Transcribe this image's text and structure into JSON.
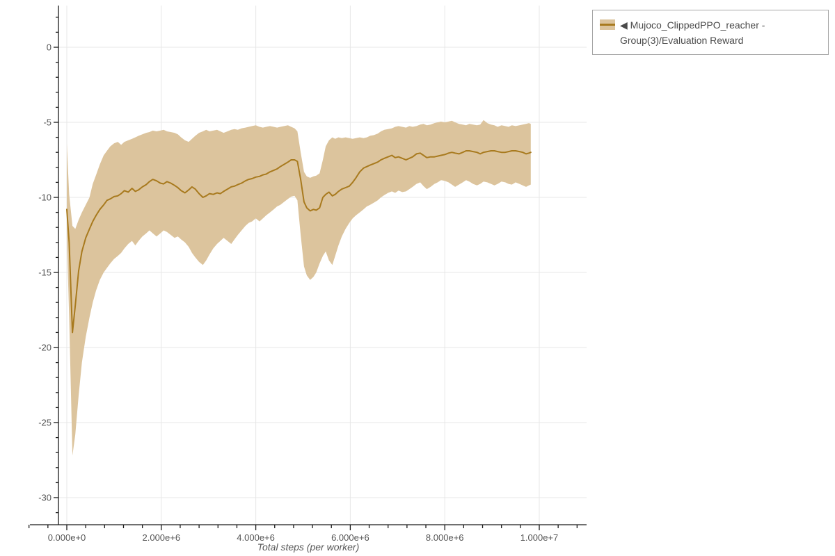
{
  "colors": {
    "background": "#ffffff",
    "axis": "#1a1a1a",
    "grid": "#e7e7e7",
    "tick_label": "#555555",
    "axis_label": "#555555",
    "legend_border": "#a6a6a6",
    "legend_text": "#4a4a4a"
  },
  "legend": {
    "label": "◀ Mujoco_ClippedPPO_reacher - Group(3)/Evaluation Reward"
  },
  "chart_data": {
    "type": "line",
    "title": "",
    "xlabel": "Total steps (per worker)",
    "ylabel": "",
    "xlim": [
      -800000,
      11200000
    ],
    "ylim": [
      -31.8,
      2.8
    ],
    "grid": true,
    "legend_position": "top-right",
    "x_ticks": [
      {
        "value": 0,
        "label": "0.000e+0"
      },
      {
        "value": 2000000,
        "label": "2.000e+6"
      },
      {
        "value": 4000000,
        "label": "4.000e+6"
      },
      {
        "value": 6000000,
        "label": "6.000e+6"
      },
      {
        "value": 8000000,
        "label": "8.000e+6"
      },
      {
        "value": 10000000,
        "label": "1.000e+7"
      }
    ],
    "x_minor_step": 400000,
    "y_ticks": [
      {
        "value": 0,
        "label": "0"
      },
      {
        "value": -5,
        "label": "-5"
      },
      {
        "value": -10,
        "label": "-10"
      },
      {
        "value": -15,
        "label": "-15"
      },
      {
        "value": -20,
        "label": "-20"
      },
      {
        "value": -25,
        "label": "-25"
      },
      {
        "value": -30,
        "label": "-30"
      }
    ],
    "y_minor_step": 1,
    "series": [
      {
        "name": "Mujoco_ClippedPPO_reacher - Group(3)/Evaluation Reward",
        "color": "#a87a1e",
        "band_color": "#dcc49d",
        "points_format": [
          "x_steps",
          "mean",
          "lower",
          "upper"
        ],
        "points": [
          [
            0,
            -10.8,
            -12.6,
            -6.4
          ],
          [
            50000,
            -13,
            -18,
            -9.8
          ],
          [
            120000,
            -19,
            -27.2,
            -11.9
          ],
          [
            180000,
            -17.2,
            -25.8,
            -12.1
          ],
          [
            250000,
            -14.9,
            -23.2,
            -11.5
          ],
          [
            320000,
            -13.6,
            -21,
            -11
          ],
          [
            400000,
            -12.7,
            -19.3,
            -10.5
          ],
          [
            480000,
            -12.1,
            -18,
            -10
          ],
          [
            550000,
            -11.6,
            -17,
            -9.1
          ],
          [
            620000,
            -11.2,
            -16.2,
            -8.5
          ],
          [
            700000,
            -10.8,
            -15.5,
            -7.8
          ],
          [
            780000,
            -10.5,
            -15,
            -7.2
          ],
          [
            850000,
            -10.2,
            -14.7,
            -6.9
          ],
          [
            920000,
            -10.1,
            -14.4,
            -6.6
          ],
          [
            1000000,
            -9.95,
            -14.1,
            -6.4
          ],
          [
            1080000,
            -9.9,
            -13.9,
            -6.3
          ],
          [
            1150000,
            -9.75,
            -13.7,
            -6.5
          ],
          [
            1220000,
            -9.55,
            -13.4,
            -6.3
          ],
          [
            1300000,
            -9.65,
            -13.1,
            -6.2
          ],
          [
            1380000,
            -9.4,
            -12.9,
            -6.1
          ],
          [
            1450000,
            -9.6,
            -13.2,
            -6
          ],
          [
            1520000,
            -9.5,
            -12.9,
            -5.9
          ],
          [
            1600000,
            -9.3,
            -12.6,
            -5.8
          ],
          [
            1680000,
            -9.15,
            -12.4,
            -5.7
          ],
          [
            1750000,
            -8.95,
            -12.2,
            -5.65
          ],
          [
            1820000,
            -8.8,
            -12.4,
            -5.55
          ],
          [
            1900000,
            -8.9,
            -12.6,
            -5.6
          ],
          [
            1980000,
            -9.05,
            -12.4,
            -5.55
          ],
          [
            2050000,
            -9.1,
            -12.2,
            -5.5
          ],
          [
            2120000,
            -8.95,
            -12.3,
            -5.6
          ],
          [
            2200000,
            -9.05,
            -12.5,
            -5.65
          ],
          [
            2280000,
            -9.2,
            -12.7,
            -5.7
          ],
          [
            2350000,
            -9.35,
            -12.6,
            -5.8
          ],
          [
            2420000,
            -9.55,
            -12.8,
            -6
          ],
          [
            2500000,
            -9.7,
            -13,
            -6.2
          ],
          [
            2580000,
            -9.5,
            -13.3,
            -6.3
          ],
          [
            2650000,
            -9.3,
            -13.7,
            -6.1
          ],
          [
            2720000,
            -9.45,
            -14,
            -5.9
          ],
          [
            2800000,
            -9.75,
            -14.3,
            -5.7
          ],
          [
            2880000,
            -10,
            -14.5,
            -5.6
          ],
          [
            2950000,
            -9.9,
            -14.2,
            -5.5
          ],
          [
            3020000,
            -9.75,
            -13.8,
            -5.6
          ],
          [
            3100000,
            -9.8,
            -13.4,
            -5.55
          ],
          [
            3180000,
            -9.7,
            -13.1,
            -5.5
          ],
          [
            3250000,
            -9.75,
            -12.9,
            -5.6
          ],
          [
            3320000,
            -9.6,
            -12.7,
            -5.7
          ],
          [
            3400000,
            -9.45,
            -12.9,
            -5.6
          ],
          [
            3480000,
            -9.3,
            -13.1,
            -5.5
          ],
          [
            3550000,
            -9.25,
            -12.8,
            -5.45
          ],
          [
            3620000,
            -9.15,
            -12.5,
            -5.5
          ],
          [
            3700000,
            -9.05,
            -12.2,
            -5.4
          ],
          [
            3780000,
            -8.9,
            -11.9,
            -5.35
          ],
          [
            3850000,
            -8.8,
            -11.7,
            -5.3
          ],
          [
            3920000,
            -8.75,
            -11.6,
            -5.25
          ],
          [
            4000000,
            -8.65,
            -11.4,
            -5.2
          ],
          [
            4080000,
            -8.6,
            -11.6,
            -5.3
          ],
          [
            4150000,
            -8.5,
            -11.4,
            -5.35
          ],
          [
            4220000,
            -8.45,
            -11.2,
            -5.3
          ],
          [
            4300000,
            -8.3,
            -11,
            -5.25
          ],
          [
            4380000,
            -8.2,
            -10.8,
            -5.3
          ],
          [
            4450000,
            -8.1,
            -10.6,
            -5.35
          ],
          [
            4520000,
            -7.95,
            -10.5,
            -5.3
          ],
          [
            4600000,
            -7.8,
            -10.3,
            -5.25
          ],
          [
            4680000,
            -7.65,
            -10.1,
            -5.2
          ],
          [
            4750000,
            -7.5,
            -9.95,
            -5.3
          ],
          [
            4820000,
            -7.5,
            -9.9,
            -5.4
          ],
          [
            4880000,
            -7.6,
            -10.2,
            -5.6
          ],
          [
            4950000,
            -8.8,
            -12.5,
            -7
          ],
          [
            5020000,
            -10.3,
            -14.6,
            -8.3
          ],
          [
            5080000,
            -10.7,
            -15.2,
            -8.6
          ],
          [
            5150000,
            -10.9,
            -15.5,
            -8.7
          ],
          [
            5220000,
            -10.8,
            -15.3,
            -8.6
          ],
          [
            5280000,
            -10.85,
            -15,
            -8.55
          ],
          [
            5350000,
            -10.7,
            -14.4,
            -8.4
          ],
          [
            5420000,
            -10,
            -13.9,
            -7.5
          ],
          [
            5480000,
            -9.8,
            -13.6,
            -6.6
          ],
          [
            5550000,
            -9.65,
            -14.2,
            -6.2
          ],
          [
            5620000,
            -9.9,
            -14.5,
            -6
          ],
          [
            5680000,
            -9.8,
            -13.9,
            -6.1
          ],
          [
            5750000,
            -9.6,
            -13.2,
            -6
          ],
          [
            5820000,
            -9.45,
            -12.6,
            -6.05
          ],
          [
            5900000,
            -9.35,
            -12.1,
            -6
          ],
          [
            5980000,
            -9.25,
            -11.7,
            -6.05
          ],
          [
            6050000,
            -9,
            -11.4,
            -6.1
          ],
          [
            6120000,
            -8.7,
            -11.2,
            -6.05
          ],
          [
            6200000,
            -8.3,
            -11,
            -6
          ],
          [
            6280000,
            -8.05,
            -10.8,
            -6.05
          ],
          [
            6350000,
            -7.95,
            -10.6,
            -6
          ],
          [
            6420000,
            -7.85,
            -10.5,
            -5.9
          ],
          [
            6500000,
            -7.75,
            -10.35,
            -5.85
          ],
          [
            6580000,
            -7.65,
            -10.2,
            -5.75
          ],
          [
            6650000,
            -7.5,
            -10,
            -5.6
          ],
          [
            6720000,
            -7.4,
            -9.85,
            -5.5
          ],
          [
            6800000,
            -7.3,
            -9.7,
            -5.45
          ],
          [
            6880000,
            -7.2,
            -9.6,
            -5.4
          ],
          [
            6950000,
            -7.35,
            -9.7,
            -5.3
          ],
          [
            7020000,
            -7.3,
            -9.55,
            -5.25
          ],
          [
            7100000,
            -7.4,
            -9.65,
            -5.3
          ],
          [
            7180000,
            -7.5,
            -9.6,
            -5.35
          ],
          [
            7250000,
            -7.4,
            -9.45,
            -5.25
          ],
          [
            7320000,
            -7.3,
            -9.3,
            -5.3
          ],
          [
            7400000,
            -7.1,
            -9.1,
            -5.25
          ],
          [
            7480000,
            -7.05,
            -9,
            -5.15
          ],
          [
            7550000,
            -7.2,
            -9.25,
            -5.1
          ],
          [
            7620000,
            -7.35,
            -9.45,
            -5.2
          ],
          [
            7700000,
            -7.3,
            -9.3,
            -5.15
          ],
          [
            7780000,
            -7.3,
            -9.1,
            -5.05
          ],
          [
            7850000,
            -7.25,
            -9,
            -5
          ],
          [
            7920000,
            -7.2,
            -8.85,
            -4.95
          ],
          [
            8000000,
            -7.15,
            -8.9,
            -5
          ],
          [
            8080000,
            -7.05,
            -9,
            -4.95
          ],
          [
            8150000,
            -7,
            -9.15,
            -4.9
          ],
          [
            8220000,
            -7.05,
            -9.3,
            -5
          ],
          [
            8300000,
            -7.1,
            -9.15,
            -5.1
          ],
          [
            8380000,
            -7,
            -9,
            -5.15
          ],
          [
            8450000,
            -6.9,
            -8.85,
            -5.2
          ],
          [
            8520000,
            -6.9,
            -8.95,
            -5.1
          ],
          [
            8600000,
            -6.95,
            -9.1,
            -5.15
          ],
          [
            8680000,
            -7,
            -9.2,
            -5.2
          ],
          [
            8750000,
            -7.1,
            -9.1,
            -5.15
          ],
          [
            8820000,
            -7,
            -8.95,
            -4.85
          ],
          [
            8900000,
            -6.95,
            -9,
            -5.05
          ],
          [
            8980000,
            -6.9,
            -9.1,
            -5.15
          ],
          [
            9050000,
            -6.9,
            -9.2,
            -5.2
          ],
          [
            9120000,
            -6.95,
            -9.1,
            -5.3
          ],
          [
            9200000,
            -7,
            -8.95,
            -5.2
          ],
          [
            9280000,
            -7,
            -9,
            -5.25
          ],
          [
            9350000,
            -6.95,
            -9.1,
            -5.3
          ],
          [
            9420000,
            -6.9,
            -9.15,
            -5.2
          ],
          [
            9500000,
            -6.9,
            -9,
            -5.25
          ],
          [
            9580000,
            -6.95,
            -9.1,
            -5.2
          ],
          [
            9650000,
            -7,
            -9.2,
            -5.15
          ],
          [
            9720000,
            -7.1,
            -9.3,
            -5.1
          ],
          [
            9780000,
            -7.05,
            -9.2,
            -5.05
          ],
          [
            9820000,
            -7,
            -9.15,
            -5.1
          ]
        ]
      }
    ]
  }
}
